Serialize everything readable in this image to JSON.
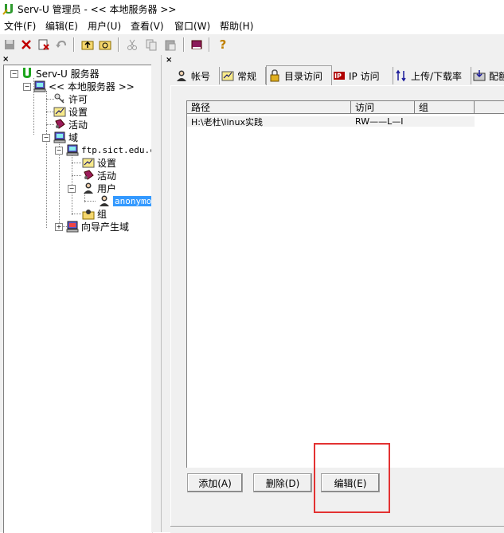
{
  "window": {
    "title": "Serv-U 管理员 - << 本地服务器 >>",
    "accent_color": "#3399ff",
    "highlight_color": "#e33232"
  },
  "menu": [
    "文件(F)",
    "编辑(E)",
    "用户(U)",
    "查看(V)",
    "窗口(W)",
    "帮助(H)"
  ],
  "toolbar": {
    "icons": [
      "save-icon",
      "delete-icon",
      "properties-icon",
      "undo-icon",
      "folder-up-icon",
      "refresh-icon",
      "cut-icon",
      "copy-icon",
      "paste-icon",
      "book-icon",
      "help-icon"
    ]
  },
  "tree": {
    "root": "Serv-U 服务器",
    "local_server": "<< 本地服务器 >>",
    "license": "许可",
    "settings": "设置",
    "activity": "活动",
    "domains": "域",
    "domain_name": "ftp.sict.edu.c",
    "domain_settings": "设置",
    "domain_activity": "活动",
    "users": "用户",
    "selected_user": "anonymous",
    "groups": "组",
    "wizard": "向导产生域"
  },
  "tabs": [
    {
      "label": "帐号",
      "icon": "user-account-icon"
    },
    {
      "label": "常规",
      "icon": "general-icon"
    },
    {
      "label": "目录访问",
      "icon": "lock-icon"
    },
    {
      "label": "IP 访问",
      "icon": "ip-icon"
    },
    {
      "label": "上传/下载率",
      "icon": "ratio-icon"
    },
    {
      "label": "配额",
      "icon": "quota-icon"
    }
  ],
  "active_tab": "目录访问",
  "list": {
    "columns": [
      "路径",
      "访问",
      "组"
    ],
    "rows": [
      {
        "path": "H:\\老杜\\linux实践",
        "access": "RW——L—I",
        "group": ""
      }
    ]
  },
  "buttons": {
    "add": "添加(A)",
    "delete": "删除(D)",
    "edit": "编辑(E)"
  }
}
